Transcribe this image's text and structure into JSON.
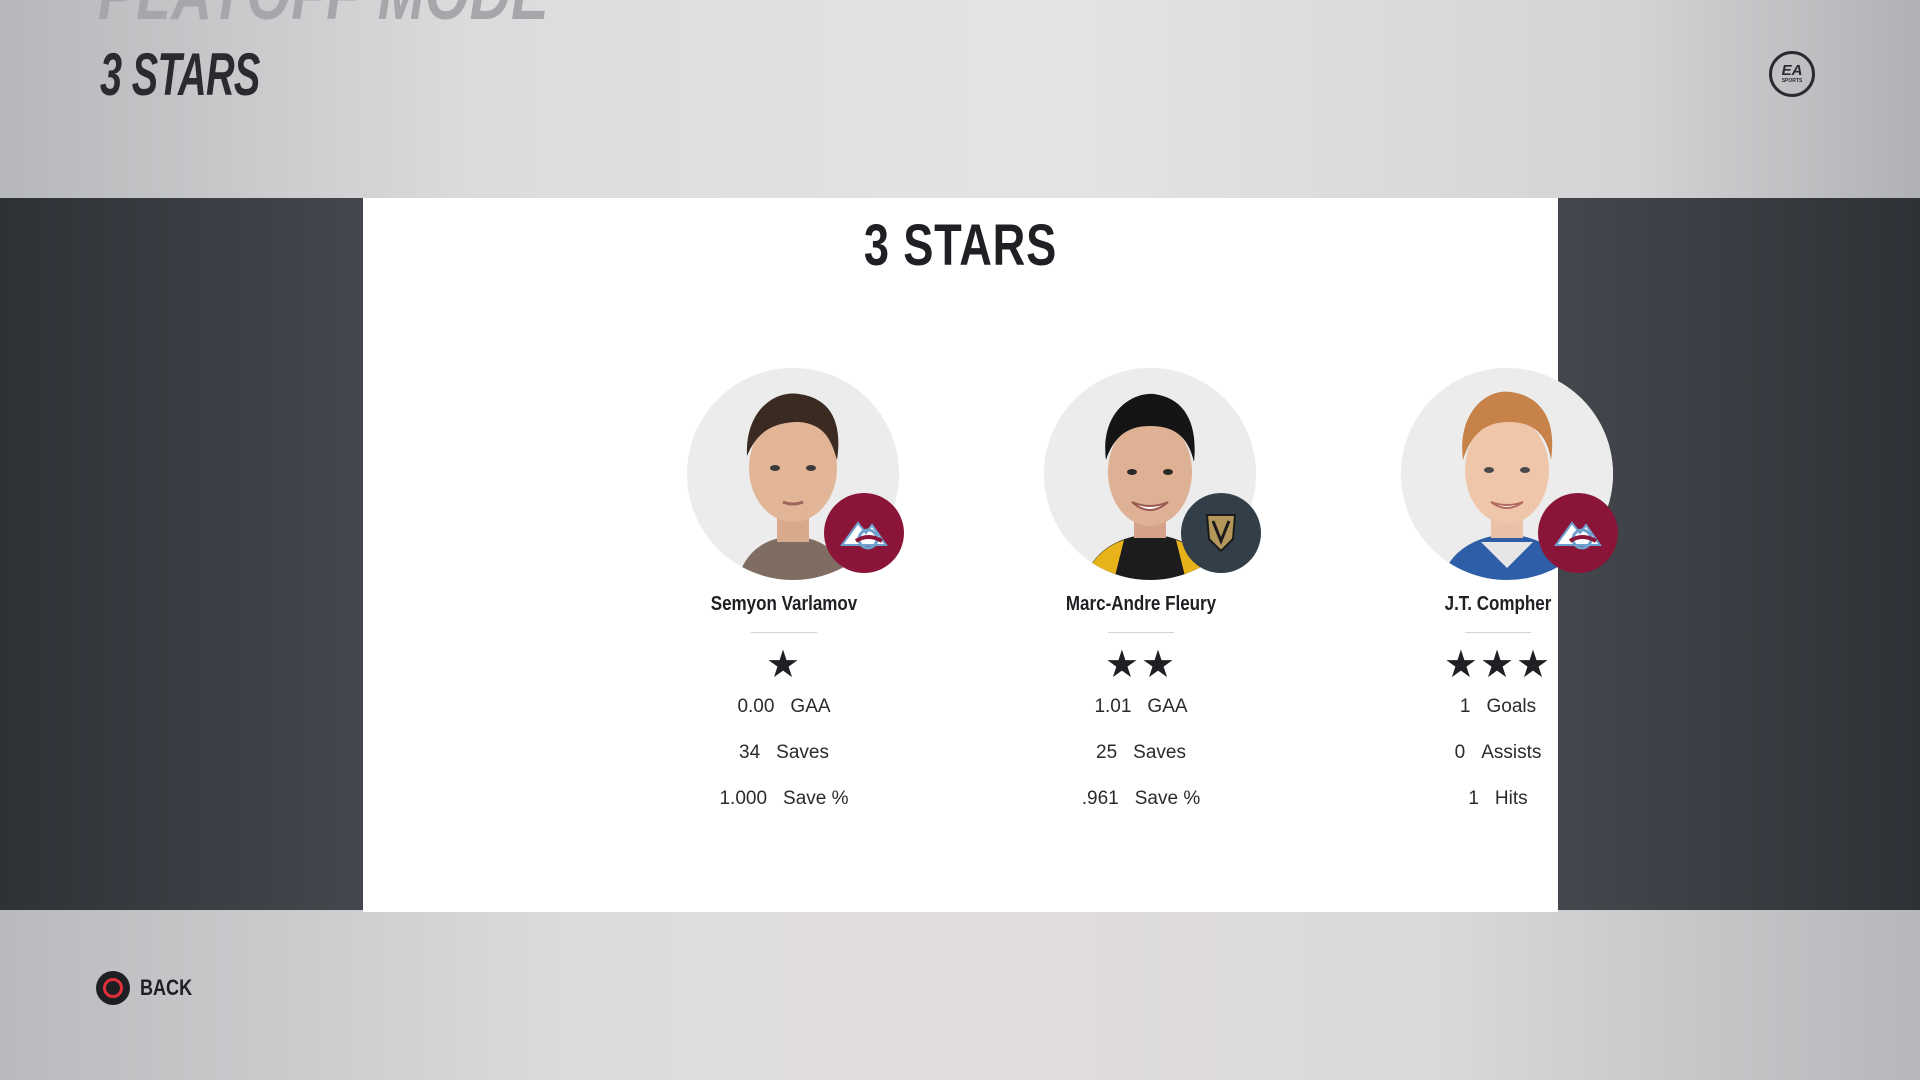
{
  "header": {
    "mode_title": "PLAYOFF MODE",
    "screen_title": "3 STARS",
    "logo_text": "EA",
    "logo_subtext": "SPORTS"
  },
  "card": {
    "title": "3 STARS",
    "players": [
      {
        "name": "Semyon Varlamov",
        "team": "Colorado Avalanche",
        "team_color": "#8a1538",
        "star_count": 1,
        "stars": "★",
        "stats": [
          {
            "value": "0.00",
            "label": "GAA"
          },
          {
            "value": "34",
            "label": "Saves"
          },
          {
            "value": "1.000",
            "label": "Save %"
          }
        ]
      },
      {
        "name": "Marc-Andre Fleury",
        "team": "Vegas Golden Knights",
        "team_color": "#333f48",
        "star_count": 2,
        "stars": "★★",
        "stats": [
          {
            "value": "1.01",
            "label": "GAA"
          },
          {
            "value": "25",
            "label": "Saves"
          },
          {
            "value": ".961",
            "label": "Save %"
          }
        ]
      },
      {
        "name": "J.T. Compher",
        "team": "Colorado Avalanche",
        "team_color": "#8a1538",
        "star_count": 3,
        "stars": "★★★",
        "stats": [
          {
            "value": "1",
            "label": "Goals"
          },
          {
            "value": "0",
            "label": "Assists"
          },
          {
            "value": "1",
            "label": "Hits"
          }
        ]
      }
    ]
  },
  "footer": {
    "back_label": "BACK",
    "back_icon": "circle-button-icon"
  }
}
